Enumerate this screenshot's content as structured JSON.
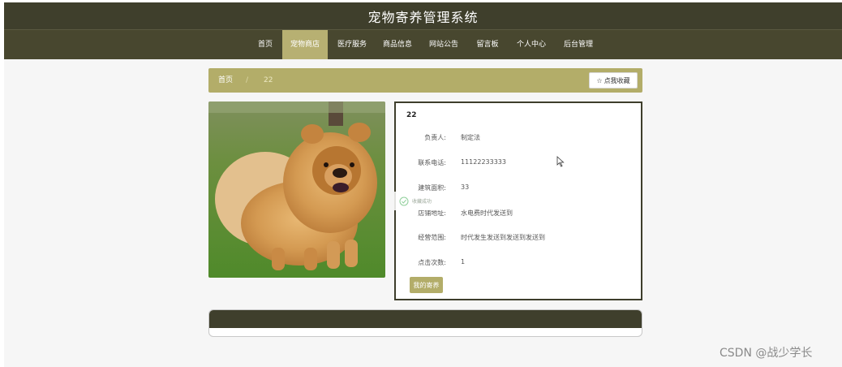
{
  "header": {
    "title": "宠物寄养管理系统"
  },
  "nav": [
    {
      "label": "首页",
      "active": false
    },
    {
      "label": "宠物商店",
      "active": true
    },
    {
      "label": "医疗服务",
      "active": false
    },
    {
      "label": "商品信息",
      "active": false
    },
    {
      "label": "网站公告",
      "active": false
    },
    {
      "label": "留言板",
      "active": false
    },
    {
      "label": "个人中心",
      "active": false
    },
    {
      "label": "后台管理",
      "active": false
    }
  ],
  "breadcrumb": {
    "home": "首页",
    "separator": "/",
    "current": "22"
  },
  "favorite": {
    "icon": "star-outline-icon",
    "label": "点我收藏"
  },
  "detail": {
    "title": "22",
    "rows": [
      {
        "label": "负责人:",
        "value": "制定法"
      },
      {
        "label": "联系电话:",
        "value": "11122233333"
      },
      {
        "label": "建筑面积:",
        "value": "33"
      },
      {
        "label": "店铺地址:",
        "value": "水电费时代发送到"
      },
      {
        "label": "经营范围:",
        "value": "时代发生发送到发送到发送到"
      },
      {
        "label": "点击次数:",
        "value": "1"
      }
    ],
    "action_label": "我的寄养"
  },
  "toast": {
    "icon": "success-icon",
    "text": "收藏成功"
  },
  "watermark": "CSDN @战少学长",
  "colors": {
    "header": "#3f3f2c",
    "nav": "#48472f",
    "accent": "#b3ad69"
  }
}
